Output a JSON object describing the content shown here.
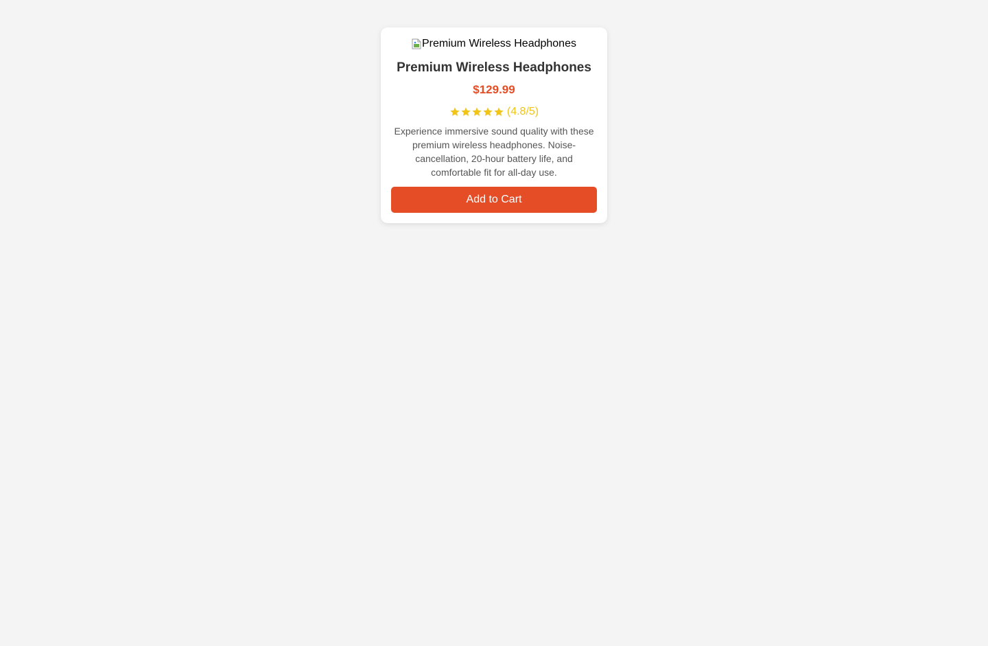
{
  "product": {
    "image_alt": "Premium Wireless Headphones",
    "image_icon": "broken-image-icon",
    "title": "Premium Wireless Headphones",
    "price": "$129.99",
    "rating": {
      "stars_filled": 5,
      "stars_total": 5,
      "text": "(4.8/5)",
      "star_icon": "star-icon"
    },
    "description": "Experience immersive sound quality with these premium wireless headphones. Noise-cancellation, 20-hour battery life, and comfortable fit for all-day use.",
    "cta_label": "Add to Cart"
  },
  "colors": {
    "background": "#f4f4f4",
    "card": "#ffffff",
    "accent": "#e44d26",
    "star": "#f0c419",
    "title": "#333333",
    "description": "#555555"
  }
}
